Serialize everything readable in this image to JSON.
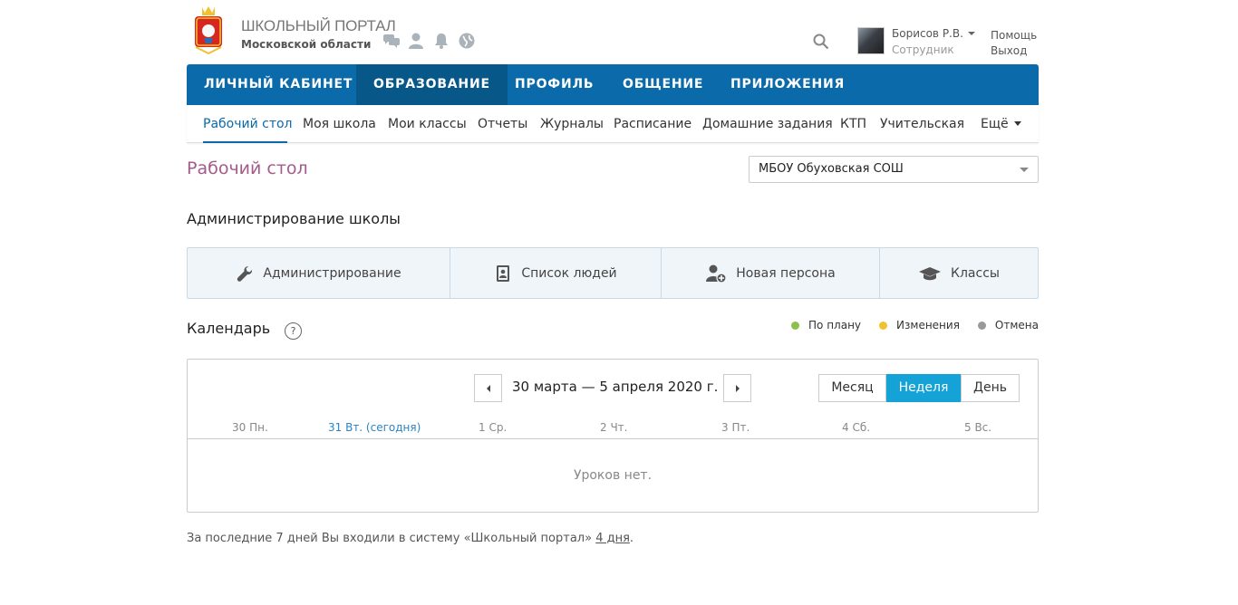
{
  "header": {
    "brand_title": "ШКОЛЬНЫЙ ПОРТАЛ",
    "brand_subtitle": "Московской области",
    "user_name": "Борисов Р.В.",
    "user_role": "Сотрудник",
    "help": "Помощь",
    "logout": "Выход",
    "icons": [
      "messages-icon",
      "person-icon",
      "bell-icon",
      "globe-icon",
      "search-icon"
    ]
  },
  "main_nav": [
    {
      "label": "ЛИЧНЫЙ КАБИНЕТ",
      "active": false
    },
    {
      "label": "ОБРАЗОВАНИЕ",
      "active": true
    },
    {
      "label": "ПРОФИЛЬ",
      "active": false
    },
    {
      "label": "ОБЩЕНИЕ",
      "active": false
    },
    {
      "label": "ПРИЛОЖЕНИЯ",
      "active": false
    }
  ],
  "sub_nav": [
    {
      "label": "Рабочий стол",
      "active": true
    },
    {
      "label": "Моя школа"
    },
    {
      "label": "Мои классы"
    },
    {
      "label": "Отчеты"
    },
    {
      "label": "Журналы"
    },
    {
      "label": "Расписание"
    },
    {
      "label": "Домашние задания"
    },
    {
      "label": "КТП"
    },
    {
      "label": "Учительская"
    },
    {
      "label": "Ещё"
    }
  ],
  "page_title": "Рабочий стол",
  "school_select": {
    "value": "МБОУ Обуховская СОШ"
  },
  "admin_section": {
    "title": "Администрирование школы",
    "buttons": [
      "Администрирование",
      "Список людей",
      "Новая персона",
      "Классы"
    ]
  },
  "calendar": {
    "title": "Календарь",
    "help": "?",
    "legend": [
      {
        "label": "По плану",
        "color": "#8cc04a"
      },
      {
        "label": "Изменения",
        "color": "#f2c12e"
      },
      {
        "label": "Отмена",
        "color": "#999999"
      }
    ],
    "range": "30 марта — 5 апреля 2020 г.",
    "views": [
      {
        "label": "Месяц",
        "active": false
      },
      {
        "label": "Неделя",
        "active": true
      },
      {
        "label": "День",
        "active": false
      }
    ],
    "days": [
      {
        "label": "30 Пн.",
        "today": false
      },
      {
        "label": "31 Вт. (сегодня)",
        "today": true
      },
      {
        "label": "1 Ср.",
        "today": false
      },
      {
        "label": "2 Чт.",
        "today": false
      },
      {
        "label": "3 Пт.",
        "today": false
      },
      {
        "label": "4 Сб.",
        "today": false
      },
      {
        "label": "5 Вс.",
        "today": false
      }
    ],
    "empty_text": "Уроков нет."
  },
  "footer": {
    "text_before": "За последние 7 дней Вы входили в систему «Школьный портал» ",
    "link": "4 дня",
    "text_after": "."
  }
}
